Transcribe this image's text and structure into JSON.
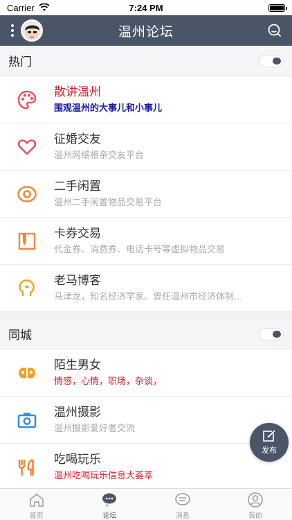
{
  "status": {
    "carrier": "Carrier",
    "time": "7:24 PM"
  },
  "nav": {
    "title": "温州论坛"
  },
  "sections": [
    {
      "label": "热门",
      "items": [
        {
          "title": "散讲温州",
          "subtitle": "围观温州的大事儿和小事儿",
          "icon": "palette-icon",
          "color": "#e8505b"
        },
        {
          "title": "征婚交友",
          "subtitle": "温州网络相亲交友平台",
          "icon": "heart-icon",
          "color": "#e8505b"
        },
        {
          "title": "二手闲置",
          "subtitle": "温州二手闲置物品交易平台",
          "icon": "target-icon",
          "color": "#f0883a"
        },
        {
          "title": "卡券交易",
          "subtitle": "代金券、消费券、电话卡号等虚拟物品交易",
          "icon": "card-icon",
          "color": "#f0883a"
        },
        {
          "title": "老马博客",
          "subtitle": "马津龙，知名经济学家。曾任温州市经济体制…",
          "icon": "head-icon",
          "color": "#f0a020"
        }
      ]
    },
    {
      "label": "同城",
      "items": [
        {
          "title": "陌生男女",
          "subtitle": "情感，心情，职场，杂谈，",
          "icon": "couple-icon",
          "color": "#f0a020"
        },
        {
          "title": "温州摄影",
          "subtitle": "温州摄影爱好者交流",
          "icon": "camera-icon",
          "color": "#2f8fe0"
        },
        {
          "title": "吃喝玩乐",
          "subtitle": "温州吃喝玩乐信息大荟萃",
          "icon": "fork-icon",
          "color": "#f0883a"
        }
      ]
    }
  ],
  "fab": {
    "label": "发布"
  },
  "tabs": [
    {
      "label": "首页"
    },
    {
      "label": "论坛"
    },
    {
      "label": "消息"
    },
    {
      "label": "我的"
    }
  ]
}
